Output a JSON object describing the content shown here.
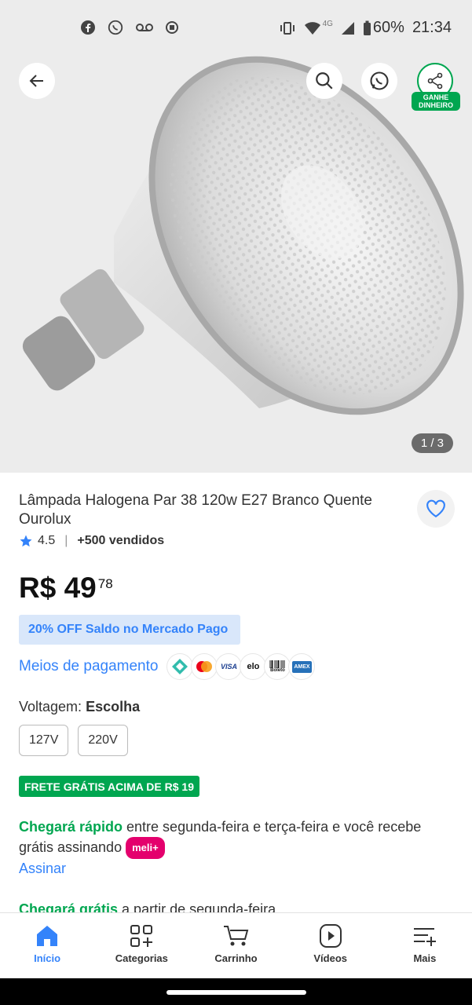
{
  "status": {
    "battery": "60%",
    "time": "21:34",
    "network": "4G"
  },
  "gallery": {
    "counter": "1 / 3",
    "share_promo": "GANHE DINHEIRO"
  },
  "product": {
    "title": "Lâmpada Halogena Par 38 120w E27 Branco Quente Ourolux",
    "rating": "4.5",
    "sold": "+500 vendidos",
    "price_int": "R$ 49",
    "price_cents": "78",
    "promo": "20% OFF Saldo no Mercado Pago",
    "payment_label": "Meios de pagamento",
    "payment_methods": [
      "pix",
      "mastercard",
      "VISA",
      "elo",
      "Boleto",
      "AMEX"
    ],
    "voltage_label": "Voltagem:",
    "voltage_value": "Escolha",
    "voltage_options": [
      "127V",
      "220V"
    ],
    "shipping_badge": "FRETE GRÁTIS ACIMA DE R$ 19",
    "delivery1_highlight": "Chegará rápido",
    "delivery1_text": " entre segunda-feira e terça-feira e você recebe grátis assinando ",
    "meli_badge": "meli+",
    "subscribe": "Assinar",
    "delivery2_highlight": "Chegará grátis",
    "delivery2_text": " a partir de segunda-feira"
  },
  "nav": [
    {
      "label": "Início",
      "active": true
    },
    {
      "label": "Categorias"
    },
    {
      "label": "Carrinho"
    },
    {
      "label": "Vídeos"
    },
    {
      "label": "Mais"
    }
  ],
  "colors": {
    "accent": "#3483fa",
    "green": "#00a650",
    "meli": "#e4006d"
  }
}
